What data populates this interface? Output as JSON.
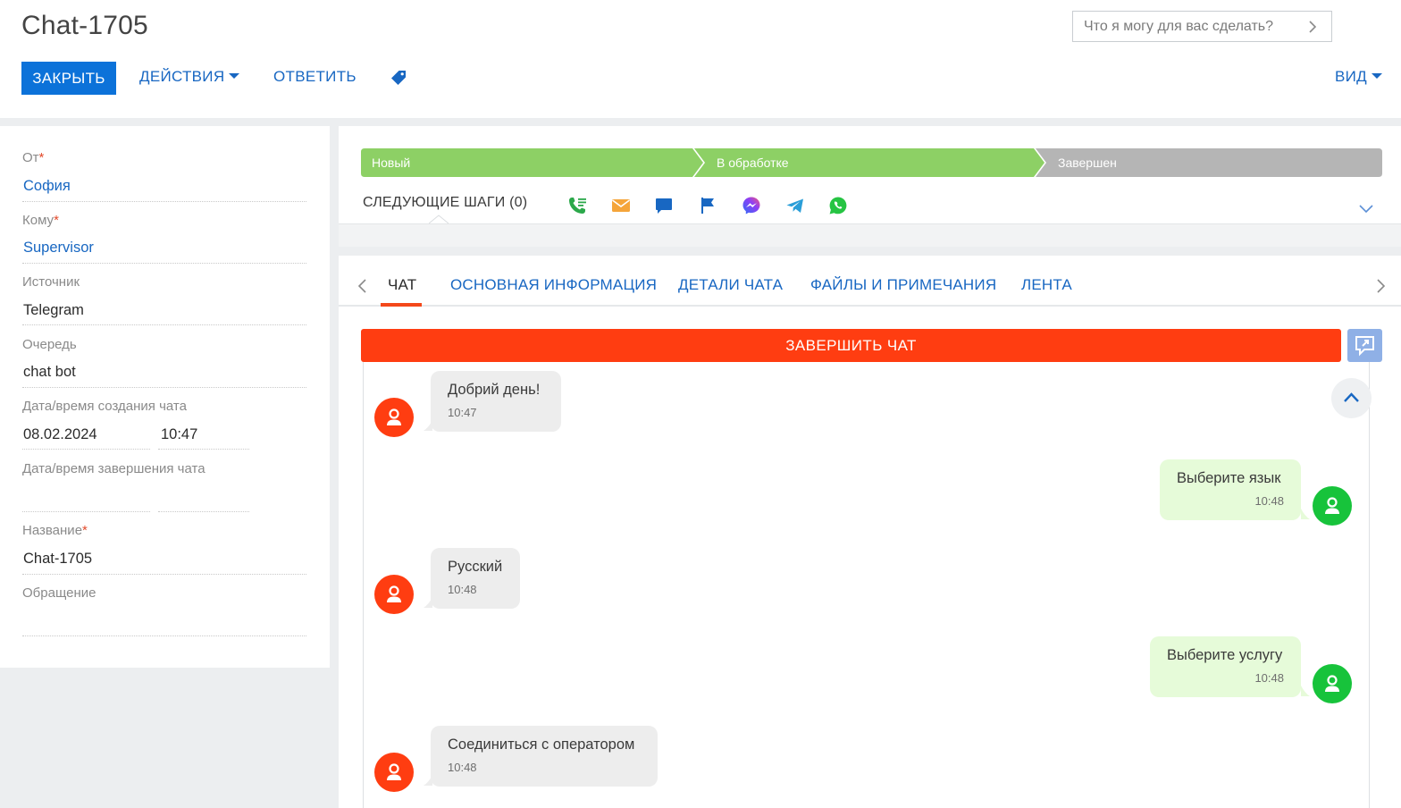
{
  "header": {
    "title": "Chat-1705",
    "command_placeholder": "Что я могу для вас сделать?"
  },
  "toolbar": {
    "close_label": "ЗАКРЫТЬ",
    "actions_label": "ДЕЙСТВИЯ",
    "reply_label": "ОТВЕТИТЬ",
    "view_label": "ВИД"
  },
  "form": {
    "from_label": "От",
    "from_value": "София",
    "to_label": "Кому",
    "to_value": "Supervisor",
    "source_label": "Источник",
    "source_value": "Telegram",
    "queue_label": "Очередь",
    "queue_value": "chat bot",
    "created_label": "Дата/время создания чата",
    "created_date": "08.02.2024",
    "created_time": "10:47",
    "finished_label": "Дата/время завершения чата",
    "finished_date": "",
    "finished_time": "",
    "name_label": "Название",
    "name_value": "Chat-1705",
    "case_label": "Обращение",
    "case_value": "",
    "required_mark": "*"
  },
  "stages": {
    "items": [
      {
        "label": "Новый",
        "state": "done"
      },
      {
        "label": "В обработке",
        "state": "done"
      },
      {
        "label": "Завершен",
        "state": "pending"
      }
    ],
    "done_color": "#8dd065",
    "pending_color": "#b5b5b5"
  },
  "next_steps": {
    "label": "СЛЕДУЮЩИЕ ШАГИ (0)",
    "icons": [
      "call-icon",
      "email-icon",
      "chat-icon",
      "flag-icon",
      "messenger-icon",
      "telegram-icon",
      "whatsapp-icon"
    ]
  },
  "tabs": {
    "items": [
      "ЧАТ",
      "ОСНОВНАЯ ИНФОРМАЦИЯ",
      "ДЕТАЛИ ЧАТА",
      "ФАЙЛЫ И ПРИМЕЧАНИЯ",
      "ЛЕНТА"
    ],
    "active": 0
  },
  "chat": {
    "end_chat_label": "ЗАВЕРШИТЬ ЧАТ",
    "messages": [
      {
        "direction": "in",
        "text": "Добрий день!",
        "time": "10:47"
      },
      {
        "direction": "out",
        "text": "Выберите язык",
        "time": "10:48"
      },
      {
        "direction": "in",
        "text": "Русский",
        "time": "10:48"
      },
      {
        "direction": "out",
        "text": "Выберите услугу",
        "time": "10:48"
      },
      {
        "direction": "in",
        "text": "Соединиться с оператором",
        "time": "10:48"
      }
    ]
  },
  "colors": {
    "primary": "#0c72d9",
    "link": "#1867c2",
    "end_chat": "#ff3d11",
    "incoming_avatar": "#ff3d11",
    "outgoing_avatar": "#17c33b",
    "incoming_bubble": "#ededed",
    "outgoing_bubble": "#e6fbd9"
  }
}
